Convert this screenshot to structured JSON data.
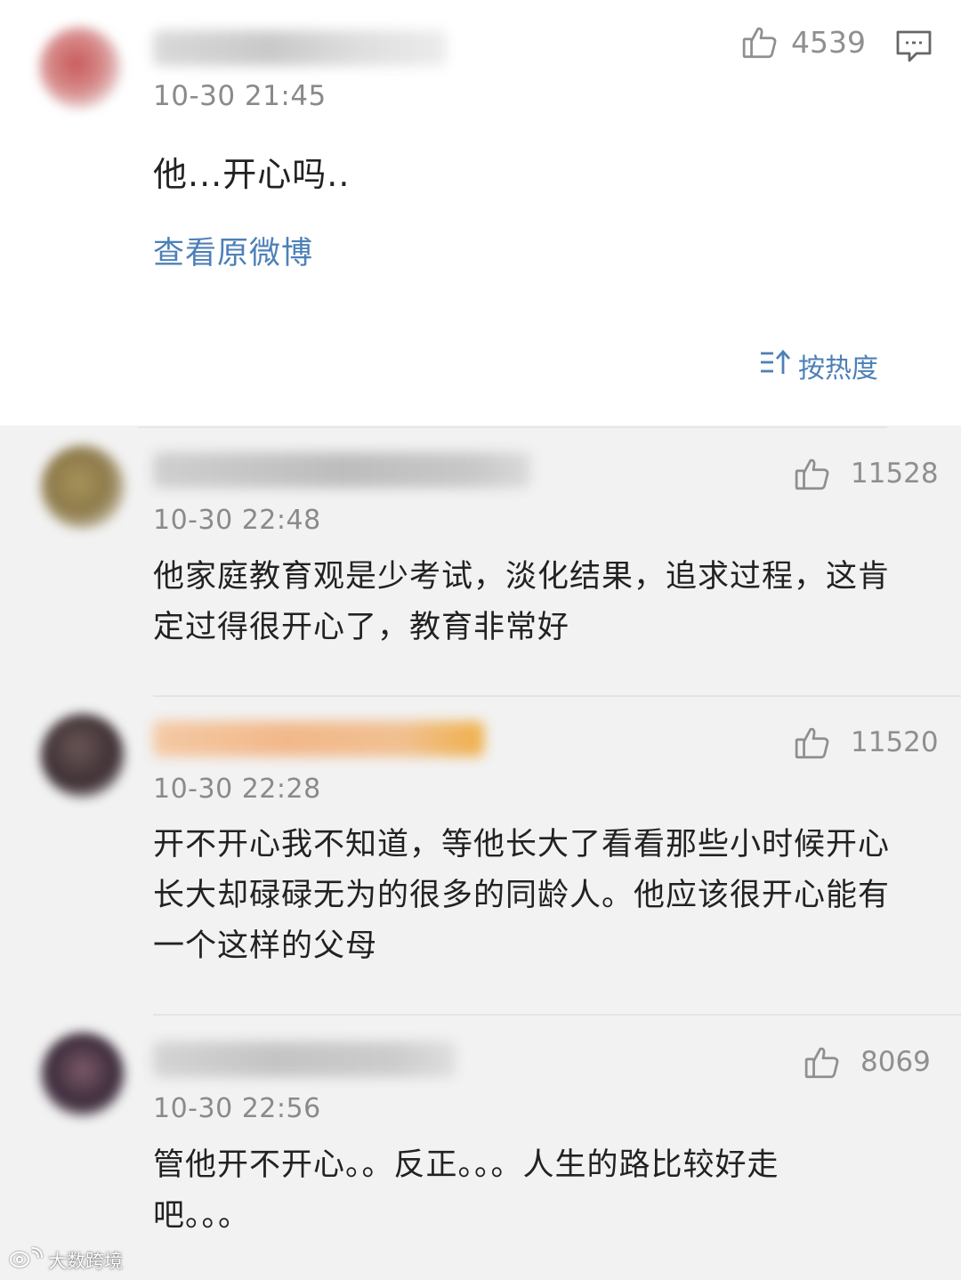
{
  "post": {
    "time": "10-30 21:45",
    "text": "他...开心吗..",
    "likes": "4539",
    "view_original": "查看原微博",
    "like_icon": "thumbs-up-icon",
    "reply_icon": "comment-icon"
  },
  "sort": {
    "label": "按热度",
    "icon": "sort-icon"
  },
  "comments": [
    {
      "time": "10-30 22:48",
      "text": "他家庭教育观是少考试，淡化结果，追求过程，这肯定过得很开心了，教育非常好",
      "likes": "11528"
    },
    {
      "time": "10-30 22:28",
      "text": "开不开心我不知道，等他长大了看看那些小时候开心长大却碌碌无为的很多的同龄人。他应该很开心能有一个这样的父母",
      "likes": "11520"
    },
    {
      "time": "10-30 22:56",
      "text": "管他开不开心。。反正。。。人生的路比较好走吧。。。",
      "likes": "8069"
    }
  ],
  "watermark": {
    "text": "大数跨境",
    "logo_icon": "weibo-logo-icon"
  },
  "colors": {
    "link": "#4d80b8",
    "background": "#f2f2f2",
    "card": "#ffffff",
    "text": "#222222",
    "meta": "#8a8a8a"
  }
}
